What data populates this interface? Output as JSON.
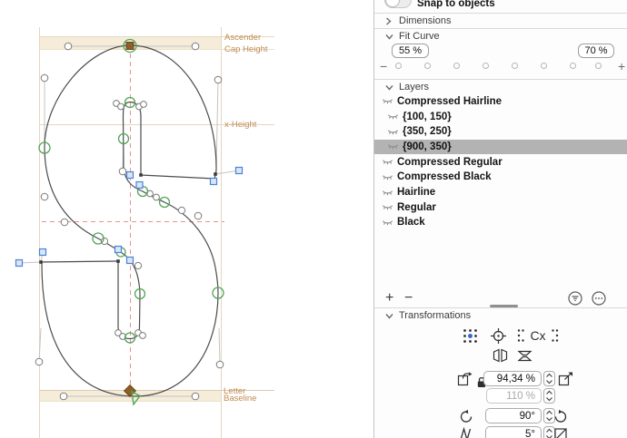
{
  "canvas": {
    "labels": {
      "ascender": "Ascender",
      "cap_height": "Cap Height",
      "x_height": "x-Height",
      "letter": "Letter",
      "baseline": "Baseline"
    },
    "colors": {
      "metric_line": "#e5d7bf",
      "metric_band": "#f5ecd9",
      "label_text": "#c08a52",
      "guide_red": "#e09494",
      "outline": "#4c4c4c",
      "node_green": "#53a558",
      "node_blue": "#4a82d8",
      "handle_gray": "#7a7a7a",
      "anchor_brown": "#8c5f28"
    }
  },
  "sidebar": {
    "snap_toggle": {
      "label": "Snap to objects",
      "state": "off"
    },
    "sections": {
      "dimensions": "Dimensions",
      "fit_curve": "Fit Curve",
      "layers": "Layers",
      "transformations": "Transformations"
    },
    "fit_curve": {
      "min_value": "55 %",
      "max_value": "70 %"
    },
    "layers": [
      {
        "label": "Compressed Hairline",
        "type": "master",
        "selected": false
      },
      {
        "label": "{100, 150}",
        "type": "intermediate",
        "selected": false
      },
      {
        "label": "{350, 250}",
        "type": "intermediate",
        "selected": false
      },
      {
        "label": "{900, 350}",
        "type": "intermediate",
        "selected": true
      },
      {
        "label": "Compressed Regular",
        "type": "master",
        "selected": false
      },
      {
        "label": "Compressed Black",
        "type": "master",
        "selected": false
      },
      {
        "label": "Hairline",
        "type": "master",
        "selected": false
      },
      {
        "label": "Regular",
        "type": "master",
        "selected": false
      },
      {
        "label": "Black",
        "type": "master",
        "selected": false
      }
    ],
    "layers_footer": {
      "add": "+",
      "remove": "−"
    },
    "transformations": {
      "cx_label": "Cx",
      "scale_x": "94,34 %",
      "scale_y": "110 %",
      "rotate": "90°",
      "slant": "5°"
    }
  }
}
